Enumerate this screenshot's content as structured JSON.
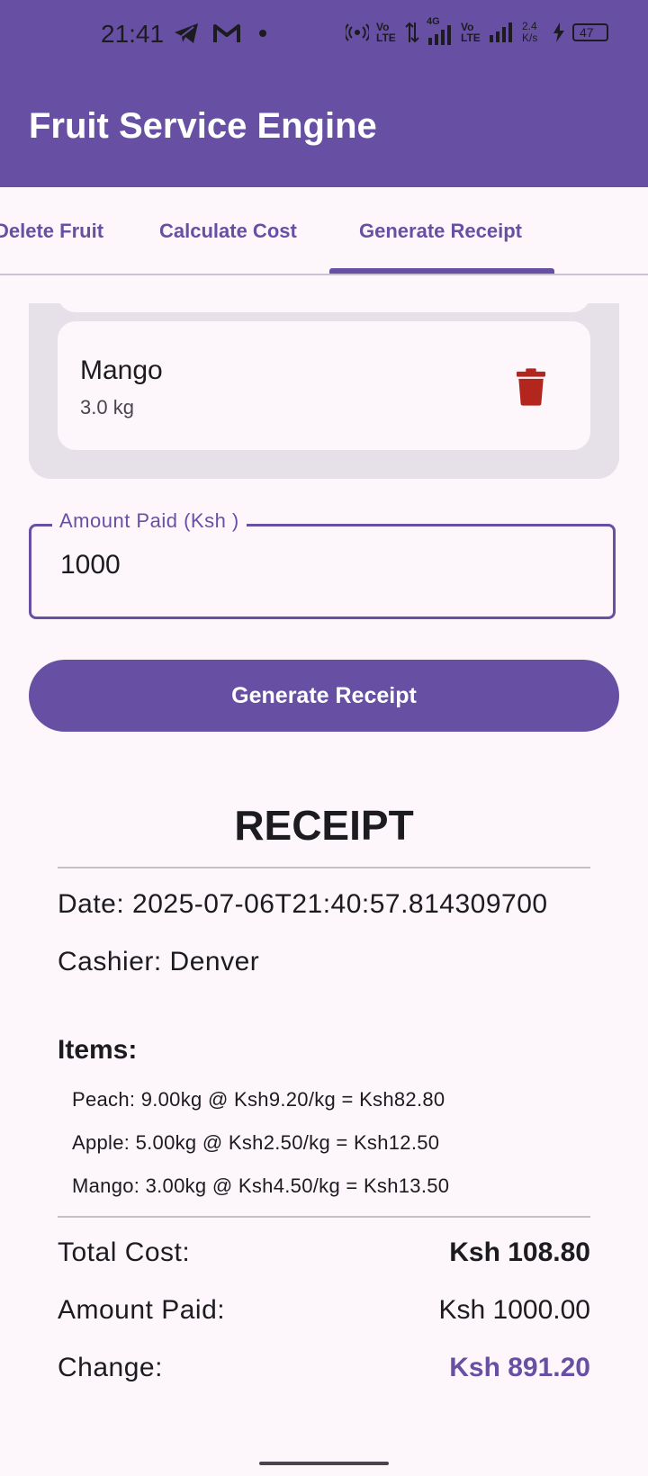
{
  "status_bar": {
    "time": "21:41",
    "volte1": "Vo LTE",
    "net_4g": "4G",
    "volte2": "Vo LTE",
    "speed": "2.4 K/s",
    "battery": "47"
  },
  "app": {
    "title": "Fruit Service Engine"
  },
  "tabs": [
    {
      "label": "Delete Fruit",
      "selected": false
    },
    {
      "label": "Calculate Cost",
      "selected": false
    },
    {
      "label": "Generate Receipt",
      "selected": true
    }
  ],
  "fruit_list": {
    "items": [
      {
        "name": "Mango",
        "quantity": "3.0 kg"
      }
    ]
  },
  "amount_field": {
    "label": "Amount Paid (Ksh )",
    "value": "1000"
  },
  "generate_button": {
    "label": "Generate Receipt"
  },
  "receipt": {
    "title": "RECEIPT",
    "date": "Date: 2025-07-06T21:40:57.814309700",
    "cashier": "Cashier: Denver",
    "items_heading": "Items:",
    "items": [
      "Peach: 9.00kg @ Ksh9.20/kg = Ksh82.80",
      "Apple: 5.00kg @ Ksh2.50/kg = Ksh12.50",
      "Mango: 3.00kg @ Ksh4.50/kg = Ksh13.50"
    ],
    "total_label": "Total Cost:",
    "total_value": "Ksh 108.80",
    "paid_label": "Amount Paid:",
    "paid_value": "Ksh 1000.00",
    "change_label": "Change:",
    "change_value": "Ksh 891.20"
  },
  "colors": {
    "primary": "#6750a4",
    "surface": "#fdf7fc",
    "container": "#e6e0e8",
    "delete": "#b3261e"
  }
}
